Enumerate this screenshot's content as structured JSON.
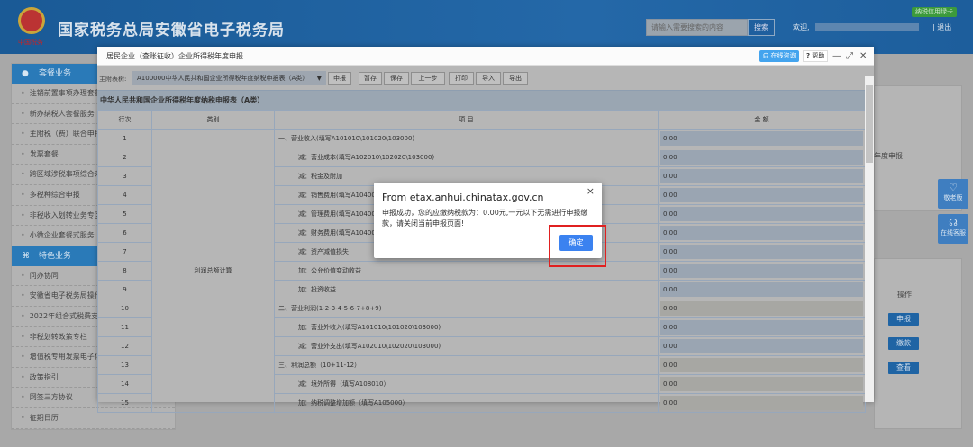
{
  "header": {
    "site_title": "国家税务总局安徽省电子税务局",
    "emblem_text": "中国税务",
    "search_placeholder": "请输入需要搜索的内容",
    "search_button": "搜索",
    "welcome": "欢迎,",
    "logout": "| 退出",
    "credit_badge": "纳税信用绿卡"
  },
  "sidebar": {
    "section1": "套餐业务",
    "items1": [
      "注销前置事项办理套餐",
      "新办纳税人套餐服务",
      "主附税（费）联合申报",
      "发票套餐",
      "跨区域涉税事项综合办",
      "多税种综合申报",
      "非税收入划转业务专区",
      "小微企业套餐式服务"
    ],
    "section2": "特色业务",
    "items2": [
      "问办协同",
      "安徽省电子税务局操作",
      "2022年组合式税费支持",
      "非税划转政策专栏",
      "增值税专用发票电子化",
      "政策指引",
      "网签三方协议",
      "征期日历"
    ]
  },
  "background": {
    "partial_text": "年度申报",
    "ops_header": "操作",
    "ops": [
      "申报",
      "缴款",
      "查看"
    ],
    "float_elder": "敬老版",
    "float_service": "在线客服"
  },
  "modal": {
    "title": "居民企业（查账征收）企业所得税年度申报",
    "consult": "在线咨询",
    "help": "帮助",
    "toolbar_label": "主附表树:",
    "select_value": "A100000中华人民共和国企业所得税年度纳税申报表（A类）",
    "buttons": [
      "申报",
      "暂存",
      "保存",
      "上一步",
      "打印",
      "导入",
      "导出"
    ],
    "table_title": "中华人民共和国企业所得税年度纳税申报表（A类）",
    "columns": [
      "行次",
      "类别",
      "项 目",
      "金 额"
    ],
    "category": "利润总额计算",
    "rows": [
      {
        "no": "1",
        "item": "一、营业收入(填写A101010\\101020\\103000)",
        "amount": "0.00",
        "indent": false,
        "readonly": false
      },
      {
        "no": "2",
        "item": "减：营业成本(填写A102010\\102020\\103000)",
        "amount": "0.00",
        "indent": true,
        "readonly": false
      },
      {
        "no": "3",
        "item": "减：税金及附加",
        "amount": "0.00",
        "indent": true,
        "readonly": false
      },
      {
        "no": "4",
        "item": "减：销售费用(填写A104000)",
        "amount": "0.00",
        "indent": true,
        "readonly": false
      },
      {
        "no": "5",
        "item": "减：管理费用(填写A104000)",
        "amount": "0.00",
        "indent": true,
        "readonly": false
      },
      {
        "no": "6",
        "item": "减：财务费用(填写A104000)",
        "amount": "0.00",
        "indent": true,
        "readonly": false
      },
      {
        "no": "7",
        "item": "减：资产减值损失",
        "amount": "0.00",
        "indent": true,
        "readonly": false
      },
      {
        "no": "8",
        "item": "加：公允价值变动收益",
        "amount": "0.00",
        "indent": true,
        "readonly": false
      },
      {
        "no": "9",
        "item": "加：投资收益",
        "amount": "0.00",
        "indent": true,
        "readonly": false
      },
      {
        "no": "10",
        "item": "二、营业利润(1-2-3-4-5-6-7+8+9)",
        "amount": "0.00",
        "indent": false,
        "readonly": true
      },
      {
        "no": "11",
        "item": "加：营业外收入(填写A101010\\101020\\103000)",
        "amount": "0.00",
        "indent": true,
        "readonly": false
      },
      {
        "no": "12",
        "item": "减：营业外支出(填写A102010\\102020\\103000)",
        "amount": "0.00",
        "indent": true,
        "readonly": false
      },
      {
        "no": "13",
        "item": "三、利润总额（10+11-12）",
        "amount": "0.00",
        "indent": false,
        "readonly": true
      },
      {
        "no": "14",
        "item": "减：境外所得（填写A108010）",
        "amount": "0.00",
        "indent": true,
        "readonly": true
      },
      {
        "no": "15",
        "item": "加：纳税调整增加额（填写A105000）",
        "amount": "0.00",
        "indent": true,
        "readonly": true
      }
    ]
  },
  "dialog": {
    "title": "From etax.anhui.chinatax.gov.cn",
    "message": "申报成功，您的应缴纳税款为：0.00元,一元以下无需进行申报缴款，请关闭当前申报页面!",
    "ok": "确定",
    "close": "×"
  }
}
